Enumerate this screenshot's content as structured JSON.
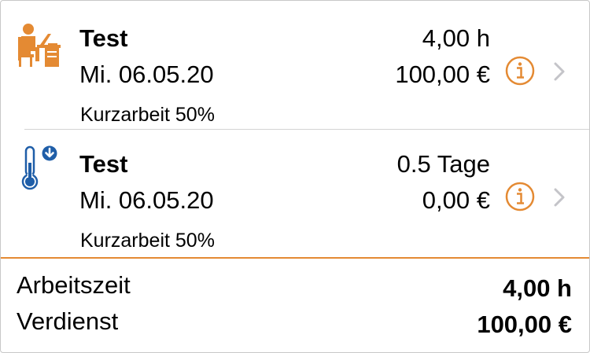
{
  "entries": [
    {
      "icon": "desk-worker-icon",
      "title": "Test",
      "date": "Mi. 06.05.20",
      "value_top": "4,00 h",
      "value_bottom": "100,00 €",
      "note": "Kurzarbeit 50%"
    },
    {
      "icon": "thermometer-down-icon",
      "title": "Test",
      "date": "Mi. 06.05.20",
      "value_top": "0.5 Tage",
      "value_bottom": "0,00 €",
      "note": "Kurzarbeit 50%"
    }
  ],
  "summary": {
    "worktime_label": "Arbeitszeit",
    "worktime_value": "4,00 h",
    "earnings_label": "Verdienst",
    "earnings_value": "100,00 €"
  },
  "colors": {
    "accent": "#e48a33",
    "thermometer": "#1f5ea8",
    "chevron": "#c4c4c9",
    "separator": "#d3d3d3"
  }
}
